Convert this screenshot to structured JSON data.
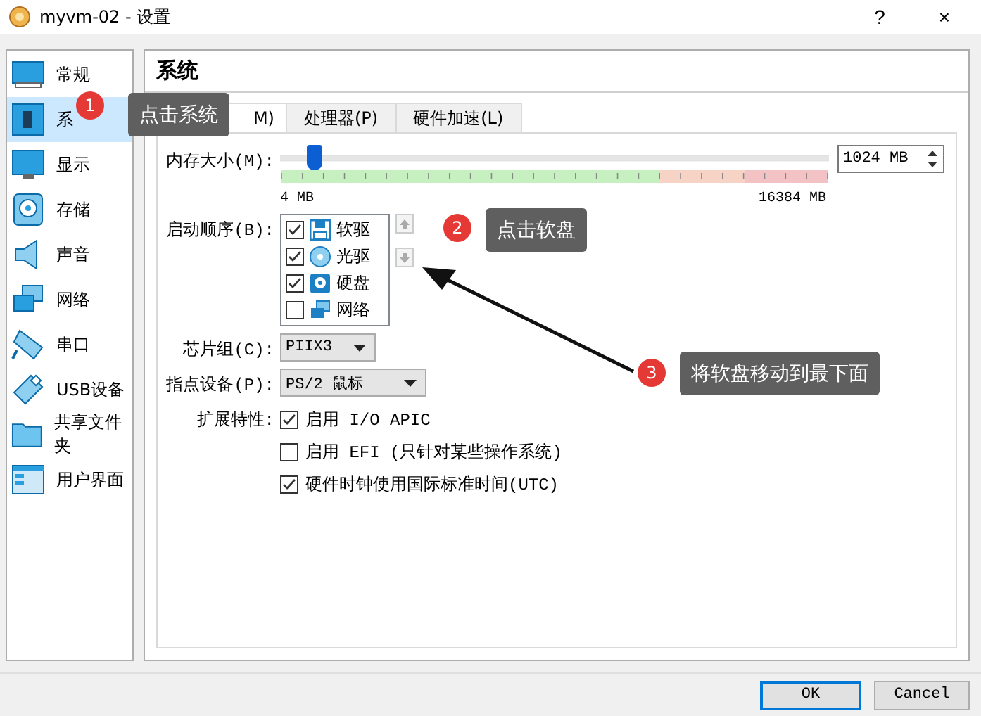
{
  "window": {
    "title": "myvm-02 - 设置",
    "help": "?",
    "close": "×"
  },
  "sidebar": {
    "items": [
      {
        "label": "常规",
        "kind": "general",
        "selected": false
      },
      {
        "label": "系",
        "kind": "system",
        "selected": true
      },
      {
        "label": "显示",
        "kind": "display",
        "selected": false
      },
      {
        "label": "存储",
        "kind": "storage",
        "selected": false
      },
      {
        "label": "声音",
        "kind": "audio",
        "selected": false
      },
      {
        "label": "网络",
        "kind": "network",
        "selected": false
      },
      {
        "label": "串口",
        "kind": "serial",
        "selected": false
      },
      {
        "label": "USB设备",
        "kind": "usb",
        "selected": false
      },
      {
        "label": "共享文件夹",
        "kind": "folder",
        "selected": false
      },
      {
        "label": "用户界面",
        "kind": "ui",
        "selected": false
      }
    ]
  },
  "panel": {
    "title": "系统",
    "tabs": [
      {
        "label": "M)",
        "selected": true
      },
      {
        "label": "处理器(P)",
        "selected": false
      },
      {
        "label": "硬件加速(L)",
        "selected": false
      }
    ],
    "memory": {
      "label": "内存大小(M):",
      "level": 0.062,
      "value": "1024 MB",
      "min": "4 MB",
      "max": "16384 MB"
    },
    "boot_order": {
      "label": "启动顺序(B):",
      "items": [
        {
          "label": "软驱",
          "kind": "floppy",
          "checked": true
        },
        {
          "label": "光驱",
          "kind": "optical",
          "checked": true
        },
        {
          "label": "硬盘",
          "kind": "disk",
          "checked": true
        },
        {
          "label": "网络",
          "kind": "network",
          "checked": false
        }
      ]
    },
    "chipset": {
      "label": "芯片组(C):",
      "value": "PIIX3"
    },
    "pointing_device": {
      "label": "指点设备(P):",
      "value": "PS/2 鼠标"
    },
    "features": {
      "label": "扩展特性:",
      "options": [
        {
          "label": "启用 I/O APIC",
          "checked": true
        },
        {
          "label": "启用 EFI (只针对某些操作系统)",
          "checked": false
        },
        {
          "label": "硬件时钟使用国际标准时间(UTC)",
          "checked": true
        }
      ]
    }
  },
  "buttons": [
    {
      "label": "OK",
      "default": true
    },
    {
      "label": "Cancel",
      "default": false
    }
  ],
  "annotations": [
    {
      "number": "1",
      "text": "点击系统"
    },
    {
      "number": "2",
      "text": "点击软盘"
    },
    {
      "number": "3",
      "text": "将软盘移动到最下面"
    }
  ]
}
